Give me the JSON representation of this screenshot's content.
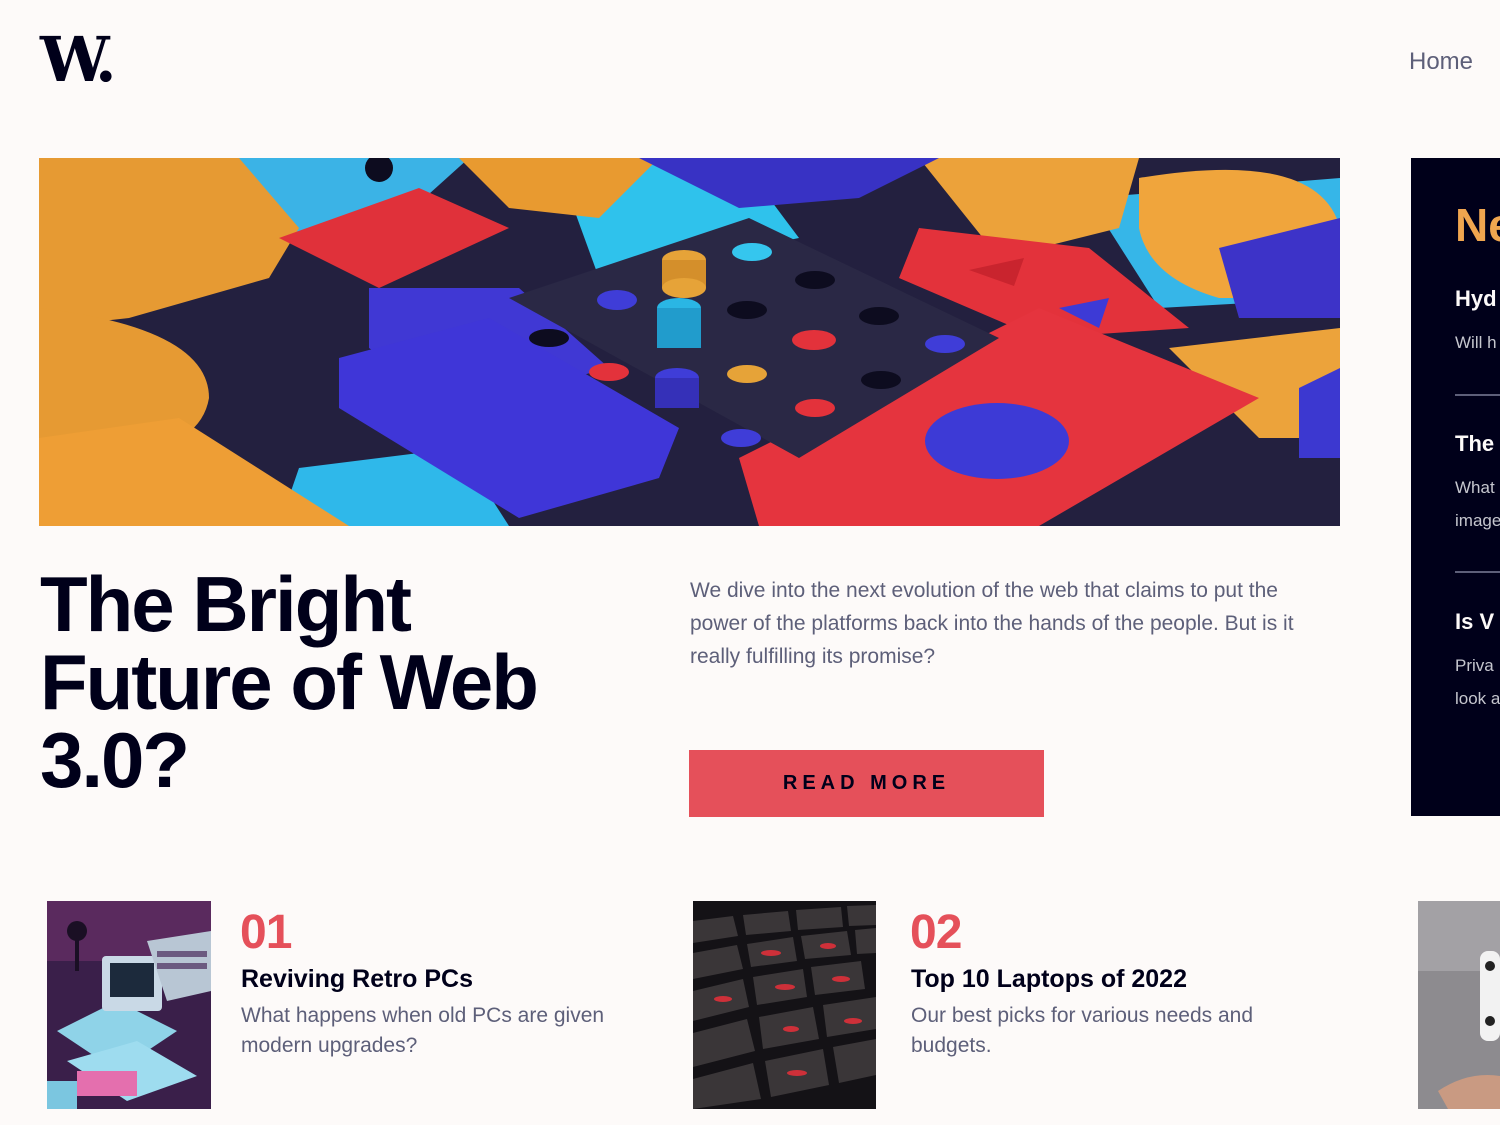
{
  "header": {
    "logo_text": "W.",
    "nav": {
      "home": "Home"
    }
  },
  "hero": {
    "image_alt": "Colorful 3D geometric blocks",
    "title": "The Bright Future of Web 3.0?",
    "description": "We dive into the next evolution of the web that claims to put the power of the platforms back into the hands of the people. But is it really fulfilling its promise?",
    "cta_label": "READ MORE"
  },
  "new_panel": {
    "heading": "Ne",
    "items": [
      {
        "title": "Hyd",
        "desc_lines": [
          "Will h"
        ]
      },
      {
        "title": "The",
        "desc_lines": [
          "What",
          "image"
        ]
      },
      {
        "title": "Is V",
        "desc_lines": [
          "Priva",
          "look a"
        ]
      }
    ]
  },
  "cards": [
    {
      "number": "01",
      "title": "Reviving Retro PCs",
      "description": "What happens when old PCs are given modern upgrades?"
    },
    {
      "number": "02",
      "title": "Top 10 Laptops of 2022",
      "description": "Our best picks for various needs and budgets."
    }
  ],
  "colors": {
    "background": "#fdfaf9",
    "dark_navy": "#00001a",
    "soft_red": "#e5505a",
    "soft_orange": "#f0a64f",
    "grayish_blue": "#5d5f79"
  }
}
